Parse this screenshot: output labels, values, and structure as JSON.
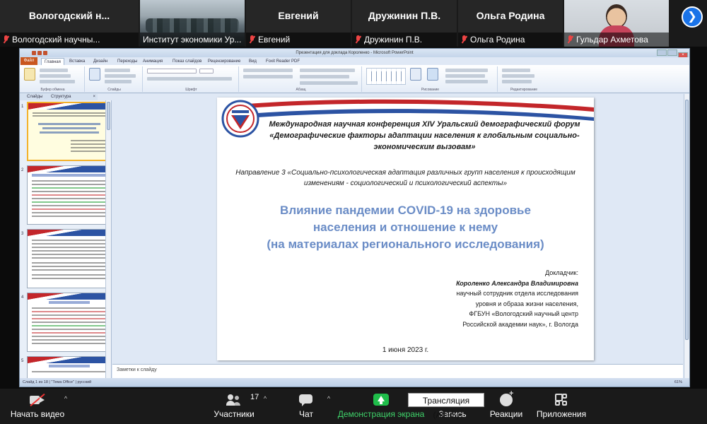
{
  "participants": [
    {
      "name_big": "Вологодский  н...",
      "name_small": "Вологодский научны...",
      "type": "name"
    },
    {
      "name_big": "",
      "name_small": "Институт экономики Ур...",
      "type": "video"
    },
    {
      "name_big": "Евгений",
      "name_small": "Евгений",
      "type": "name"
    },
    {
      "name_big": "Дружинин П.В.",
      "name_small": "Дружинин П.В.",
      "type": "name"
    },
    {
      "name_big": "Ольга Родина",
      "name_small": "Ольга Родина",
      "type": "name"
    },
    {
      "name_big": "",
      "name_small": "Гульдар Ахметова",
      "type": "face"
    }
  ],
  "strip_next": "❯",
  "ppt": {
    "title": "Презентация для доклада Короленко - Microsoft PowerPoint",
    "file_tab": "Файл",
    "tabs": [
      "Главная",
      "Вставка",
      "Дизайн",
      "Переходы",
      "Анимация",
      "Показ слайдов",
      "Рецензирование",
      "Вид",
      "Foxit Reader PDF"
    ],
    "ribbon_groups": [
      "Буфер обмена",
      "Слайды",
      "Шрифт",
      "Абзац",
      "Рисование",
      "Редактирование"
    ],
    "pane_tabs": [
      "Слайды",
      "Структура"
    ],
    "pane_close": "×",
    "notes_placeholder": "Заметки к слайду",
    "status_left": "Слайд 1 из 18   |   \"Тема Office\"   |   русский",
    "status_right": "61%",
    "slide_numbers": [
      "1",
      "2",
      "3",
      "4",
      "5"
    ]
  },
  "slide": {
    "conference": "Международная научная конференция XIV Уральский демографический форум «Демографические факторы адаптации населения к глобальным социально-экономическим вызовам»",
    "direction": "Направление 3 «Социально-психологическая адаптация различных групп населения к происходящим изменениям - социологический и психологический аспекты»",
    "topic_1": "Влияние пандемии COVID-19 на здоровье",
    "topic_2": "населения и отношение к нему",
    "topic_3": "(на материалах регионального исследования)",
    "speaker_label": "Докладчик:",
    "speaker_name": "Короленко Александра Владимировна",
    "speaker_pos_1": "научный сотрудник отдела исследования",
    "speaker_pos_2": "уровня и образа жизни населения,",
    "speaker_pos_3": "ФГБУН «Вологодский научный центр",
    "speaker_pos_4": "Российской академии наук», г. Вологда",
    "date": "1 июня 2023 г."
  },
  "toolbar": {
    "video": "Начать видео",
    "participants": "Участники",
    "participants_count": "17",
    "chat": "Чат",
    "share": "Демонстрация экрана",
    "record": "Запись",
    "reactions": "Реакции",
    "apps": "Приложения",
    "caret": "^"
  },
  "tooltip": "Трансляция (Alt+S)",
  "colors": {
    "share_green": "#1fbd4a",
    "accent_blue": "#1a73e8",
    "topic_blue": "#6a8cc6",
    "mute_red": "#e44444"
  }
}
